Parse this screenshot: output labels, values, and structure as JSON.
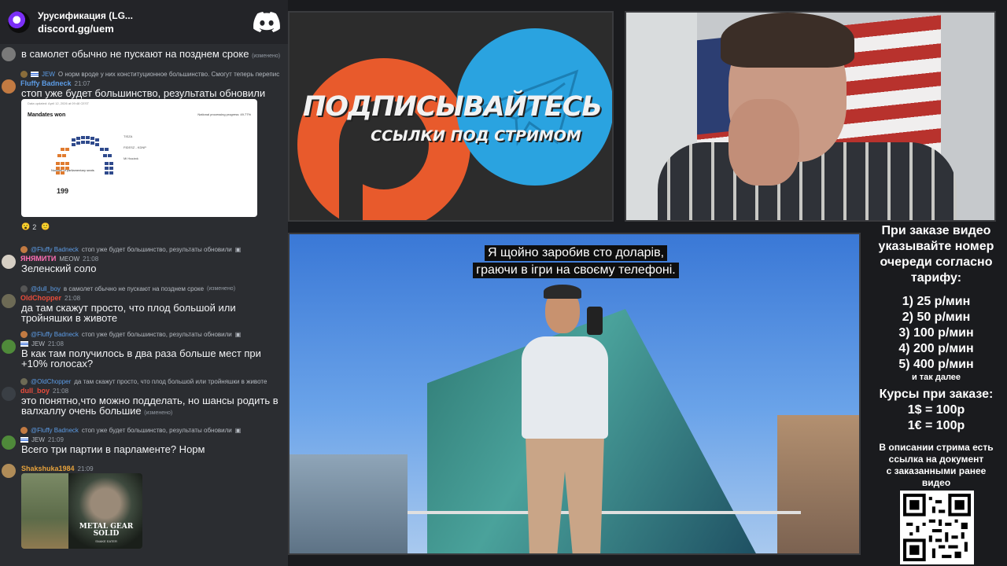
{
  "chat": {
    "server_name": "Урусификация (LG...",
    "server_link": "discord.gg/uem",
    "messages": [
      {
        "text": "в самолет обычно не пускают на позднем сроке",
        "edited": "(изменено)"
      },
      {
        "reply_user": "JEW",
        "reply_text": "О норм вроде у них конституционное большинство. Смогут теперь перепис",
        "user": "Fluffy Badneck",
        "time": "21:07",
        "text": "стоп уже будет большинство, результаты обновили"
      },
      {
        "reply_user": "@Fluffy Badneck",
        "reply_text": "стоп уже будет большинство, результаты обновили",
        "user": "ЯНЯМИТИ",
        "badge": "MEOW",
        "time": "21:08",
        "text": "Зеленский соло"
      },
      {
        "reply_user": "@dull_boy",
        "reply_text": "в самолет обычно не пускают на позднем сроке",
        "reply_edited": "(изменено)",
        "user": "OldChopper",
        "time": "21:08",
        "text": "да там скажут просто, что плод большой или тройняшки в животе"
      },
      {
        "reply_user": "@Fluffy Badneck",
        "reply_text": "стоп уже будет большинство, результаты обновили",
        "badge": "JEW",
        "time": "21:08",
        "text": "В как там получилось в два раза больше мест при +10% голосах?"
      },
      {
        "reply_user": "@OldChopper",
        "reply_text": "да там скажут просто, что плод большой или тройняшки в животе",
        "user": "dull_boy",
        "time": "21:08",
        "text": "это понятно,что можно подделать, но шансы родить в валхаллу очень большие",
        "edited": "(изменено)"
      },
      {
        "reply_user": "@Fluffy Badneck",
        "reply_text": "стоп уже будет большинство, результаты обновили",
        "badge": "JEW",
        "time": "21:09",
        "text": "Всего три партии в парламенте? Норм"
      },
      {
        "user": "Shakshuka1984",
        "time": "21:09"
      }
    ],
    "embed": {
      "top_note": "Data updated: April 12, 2026 at 09:48 CEST",
      "title": "Mandates won",
      "progress": "National processing progress: 49.77%",
      "note": "Number of parliamentary seats",
      "total": "199",
      "parties": [
        "TISZA",
        "FIDESZ - KDNP",
        "Mi Hazánk"
      ]
    },
    "reactions": [
      "2",
      ""
    ],
    "mgs_title": "METAL GEAR SOLID",
    "mgs_sub": "SNAKE EATER"
  },
  "promo": {
    "headline": "ПОДПИСЫВАЙТЕСЬ",
    "subline": "ССЫЛКИ ПОД СТРИМОМ"
  },
  "video": {
    "subtitle_line1": "Я щойно заробив сто доларів,",
    "subtitle_line2": "граючи в ігри на своєму телефоні."
  },
  "info": {
    "line1": "При заказе видео",
    "line2": "указывайте номер",
    "line3": "очереди согласно",
    "line4": "тарифу:",
    "price1": "1) 25 р/мин",
    "price2": "2) 50 р/мин",
    "price3": "3) 100 р/мин",
    "price4": "4) 200 р/мин",
    "price5": "5) 400 р/мин",
    "etc": "и так далее",
    "rates_title": "Курсы при заказе:",
    "rate1": "1$ = 100р",
    "rate2": "1€ = 100р",
    "desc1": "В описании стрима есть",
    "desc2": "ссылка на документ",
    "desc3": "с заказанными ранее",
    "desc4": "видео"
  },
  "colors": {
    "chat_bg": "#2b2d31",
    "telegram_blue": "#2aa3e0",
    "boosty_orange": "#e85a2c",
    "username_blue": "#5c9ce6",
    "username_red": "#e74c3c",
    "username_pink": "#ff6fb5"
  }
}
